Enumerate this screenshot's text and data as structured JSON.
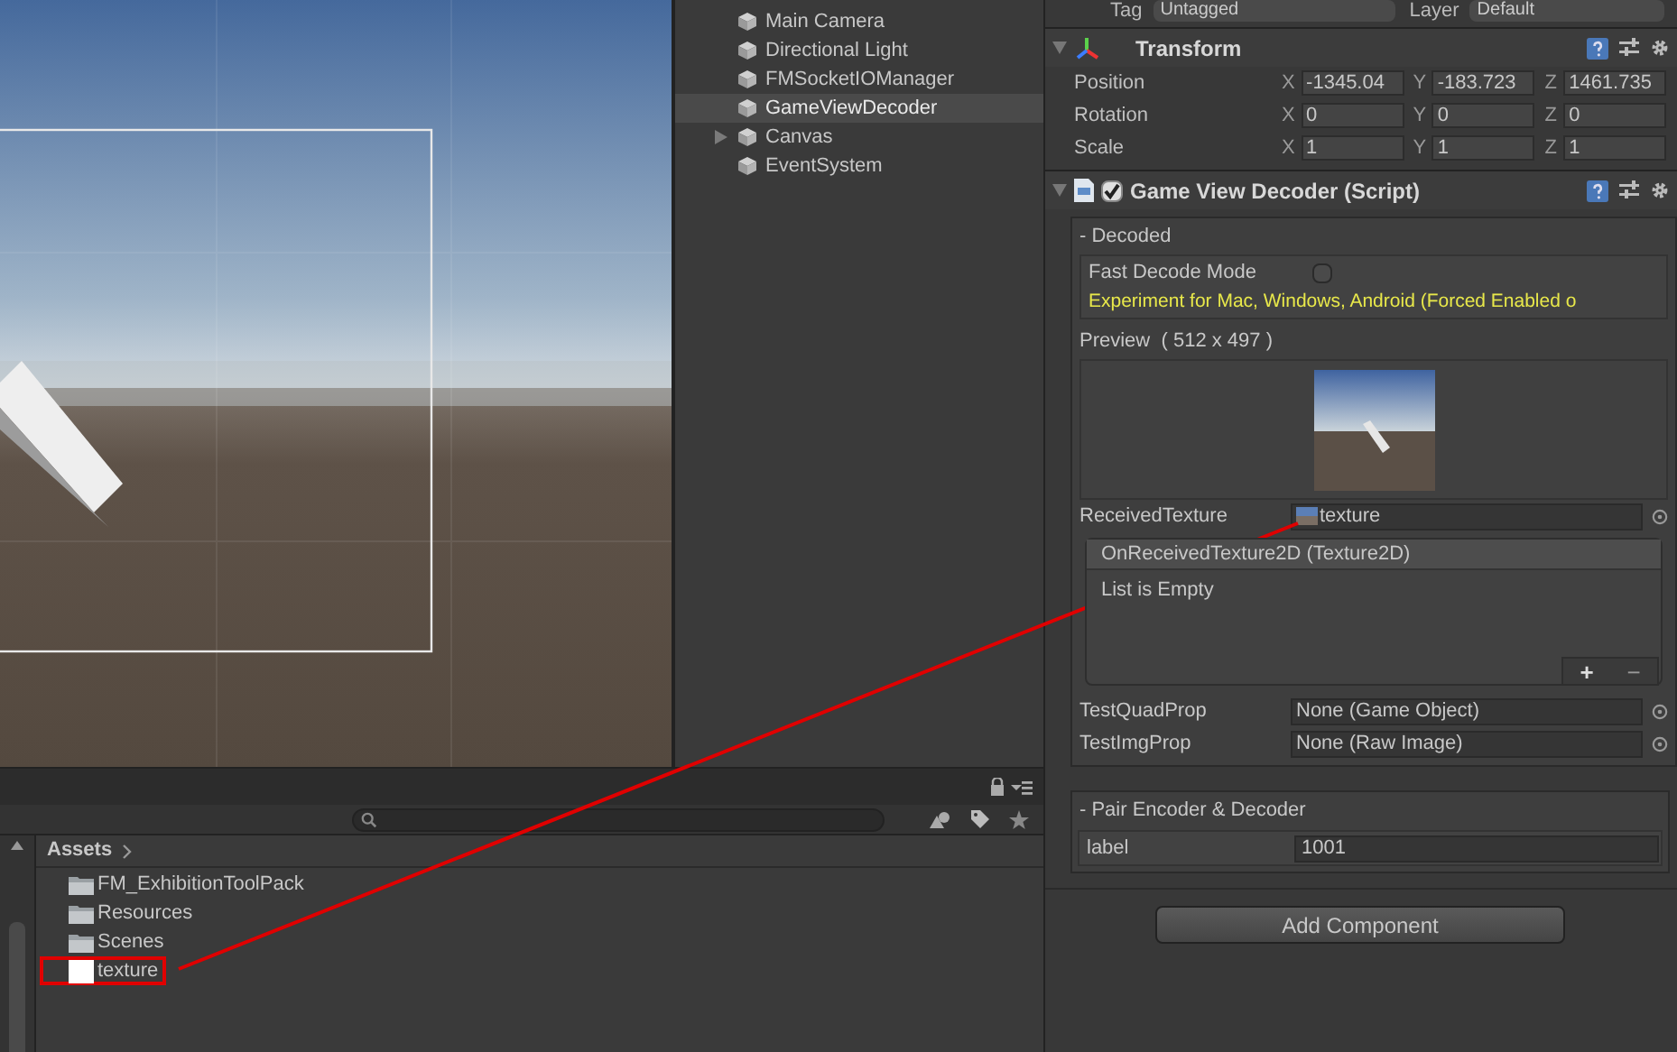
{
  "hierarchy": {
    "items": [
      {
        "label": "Main Camera",
        "selected": false,
        "expandable": false
      },
      {
        "label": "Directional Light",
        "selected": false,
        "expandable": false
      },
      {
        "label": "FMSocketIOManager",
        "selected": false,
        "expandable": false
      },
      {
        "label": "GameViewDecoder",
        "selected": true,
        "expandable": false
      },
      {
        "label": "Canvas",
        "selected": false,
        "expandable": true
      },
      {
        "label": "EventSystem",
        "selected": false,
        "expandable": false
      }
    ]
  },
  "inspector": {
    "tag": {
      "label": "Tag",
      "value": "Untagged"
    },
    "layer": {
      "label": "Layer",
      "value": "Default"
    },
    "transform": {
      "title": "Transform",
      "expanded": true,
      "rows": [
        {
          "label": "Position",
          "fields": [
            {
              "axis": "X",
              "value": "-1345.04"
            },
            {
              "axis": "Y",
              "value": "-183.723"
            },
            {
              "axis": "Z",
              "value": "1461.735"
            }
          ]
        },
        {
          "label": "Rotation",
          "fields": [
            {
              "axis": "X",
              "value": "0"
            },
            {
              "axis": "Y",
              "value": "0"
            },
            {
              "axis": "Z",
              "value": "0"
            }
          ]
        },
        {
          "label": "Scale",
          "fields": [
            {
              "axis": "X",
              "value": "1"
            },
            {
              "axis": "Y",
              "value": "1"
            },
            {
              "axis": "Z",
              "value": "1"
            }
          ]
        }
      ]
    },
    "script": {
      "title": "Game View Decoder (Script)",
      "enabled": true,
      "expanded": true,
      "decoded": {
        "header": "- Decoded",
        "fast_decode": {
          "label": "Fast Decode Mode",
          "checked": false
        },
        "note": "Experiment for Mac, Windows, Android (Forced Enabled o",
        "preview_label": "Preview  ( 512 x 497 )",
        "received_texture": {
          "label": "ReceivedTexture",
          "value": "texture"
        },
        "event": {
          "title": "OnReceivedTexture2D (Texture2D)",
          "empty_text": "List is Empty",
          "add": "+",
          "remove": "−"
        },
        "object_fields": [
          {
            "label": "TestQuadProp",
            "value": "None (Game Object)"
          },
          {
            "label": "TestImgProp",
            "value": "None (Raw Image)"
          }
        ]
      },
      "pair": {
        "header": "- Pair Encoder & Decoder",
        "fields": [
          {
            "label": "label",
            "value": "1001"
          }
        ]
      }
    },
    "add_component": "Add Component"
  },
  "project": {
    "breadcrumb": "Assets",
    "items": [
      {
        "label": "FM_ExhibitionToolPack",
        "kind": "folder",
        "highlighted": false
      },
      {
        "label": "Resources",
        "kind": "folder",
        "highlighted": false
      },
      {
        "label": "Scenes",
        "kind": "folder",
        "highlighted": false
      },
      {
        "label": "texture",
        "kind": "texture",
        "highlighted": true
      }
    ]
  }
}
